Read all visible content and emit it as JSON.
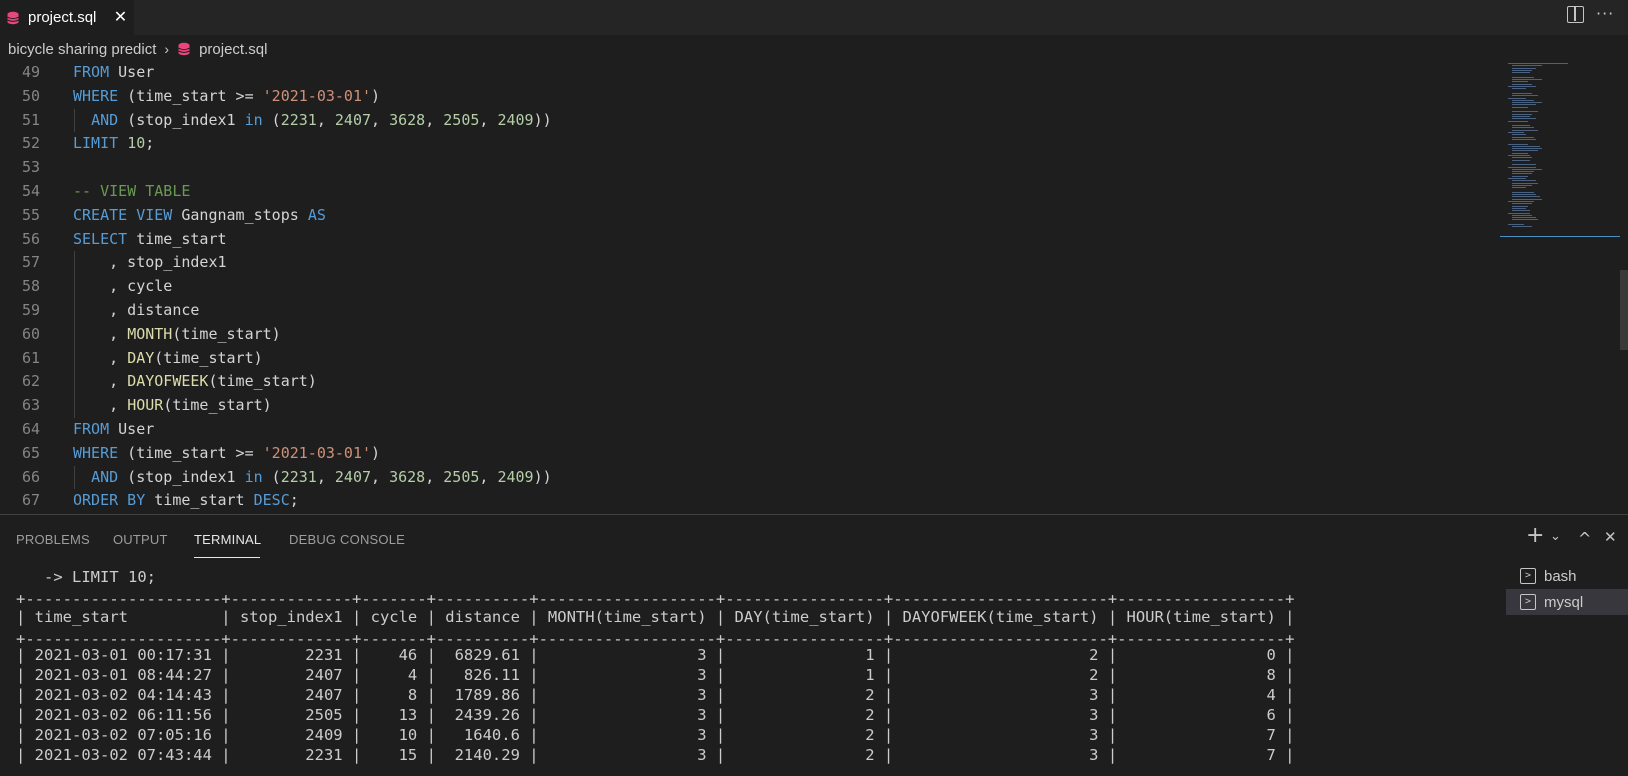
{
  "tab": {
    "label": "project.sql",
    "close": "✕"
  },
  "header_actions": {
    "more": "···"
  },
  "breadcrumb": {
    "folder": "bicycle sharing predict",
    "separator": "›",
    "file": "project.sql"
  },
  "editor": {
    "lines": [
      {
        "n": "49",
        "tokens": [
          [
            "kw",
            "FROM"
          ],
          [
            "t",
            " User"
          ]
        ]
      },
      {
        "n": "50",
        "tokens": [
          [
            "kw",
            "WHERE"
          ],
          [
            "t",
            " (time_start >= "
          ],
          [
            "str",
            "'2021-03-01'"
          ],
          [
            "t",
            ")"
          ]
        ]
      },
      {
        "n": "51",
        "tokens": [
          [
            "t",
            "  "
          ],
          [
            "kw",
            "AND"
          ],
          [
            "t",
            " (stop_index1 "
          ],
          [
            "kw",
            "in"
          ],
          [
            "t",
            " ("
          ],
          [
            "num",
            "2231"
          ],
          [
            "t",
            ", "
          ],
          [
            "num",
            "2407"
          ],
          [
            "t",
            ", "
          ],
          [
            "num",
            "3628"
          ],
          [
            "t",
            ", "
          ],
          [
            "num",
            "2505"
          ],
          [
            "t",
            ", "
          ],
          [
            "num",
            "2409"
          ],
          [
            "t",
            "))"
          ]
        ]
      },
      {
        "n": "52",
        "tokens": [
          [
            "kw",
            "LIMIT"
          ],
          [
            "t",
            " "
          ],
          [
            "num",
            "10"
          ],
          [
            "t",
            ";"
          ]
        ]
      },
      {
        "n": "53",
        "tokens": []
      },
      {
        "n": "54",
        "tokens": [
          [
            "cm",
            "-- VIEW TABLE"
          ]
        ]
      },
      {
        "n": "55",
        "tokens": [
          [
            "kw",
            "CREATE"
          ],
          [
            "t",
            " "
          ],
          [
            "kw",
            "VIEW"
          ],
          [
            "t",
            " Gangnam_stops "
          ],
          [
            "kw",
            "AS"
          ]
        ]
      },
      {
        "n": "56",
        "tokens": [
          [
            "kw",
            "SELECT"
          ],
          [
            "t",
            " time_start"
          ]
        ]
      },
      {
        "n": "57",
        "tokens": [
          [
            "t",
            "    , stop_index1"
          ]
        ]
      },
      {
        "n": "58",
        "tokens": [
          [
            "t",
            "    , cycle"
          ]
        ]
      },
      {
        "n": "59",
        "tokens": [
          [
            "t",
            "    , distance"
          ]
        ]
      },
      {
        "n": "60",
        "tokens": [
          [
            "t",
            "    , "
          ],
          [
            "fn",
            "MONTH"
          ],
          [
            "t",
            "(time_start)"
          ]
        ]
      },
      {
        "n": "61",
        "tokens": [
          [
            "t",
            "    , "
          ],
          [
            "fn",
            "DAY"
          ],
          [
            "t",
            "(time_start)"
          ]
        ]
      },
      {
        "n": "62",
        "tokens": [
          [
            "t",
            "    , "
          ],
          [
            "fn",
            "DAYOFWEEK"
          ],
          [
            "t",
            "(time_start)"
          ]
        ]
      },
      {
        "n": "63",
        "tokens": [
          [
            "t",
            "    , "
          ],
          [
            "fn",
            "HOUR"
          ],
          [
            "t",
            "(time_start)"
          ]
        ]
      },
      {
        "n": "64",
        "tokens": [
          [
            "kw",
            "FROM"
          ],
          [
            "t",
            " User"
          ]
        ]
      },
      {
        "n": "65",
        "tokens": [
          [
            "kw",
            "WHERE"
          ],
          [
            "t",
            " (time_start >= "
          ],
          [
            "str",
            "'2021-03-01'"
          ],
          [
            "t",
            ")"
          ]
        ]
      },
      {
        "n": "66",
        "tokens": [
          [
            "t",
            "  "
          ],
          [
            "kw",
            "AND"
          ],
          [
            "t",
            " (stop_index1 "
          ],
          [
            "kw",
            "in"
          ],
          [
            "t",
            " ("
          ],
          [
            "num",
            "2231"
          ],
          [
            "t",
            ", "
          ],
          [
            "num",
            "2407"
          ],
          [
            "t",
            ", "
          ],
          [
            "num",
            "3628"
          ],
          [
            "t",
            ", "
          ],
          [
            "num",
            "2505"
          ],
          [
            "t",
            ", "
          ],
          [
            "num",
            "2409"
          ],
          [
            "t",
            "))"
          ]
        ]
      },
      {
        "n": "67",
        "tokens": [
          [
            "kw",
            "ORDER BY"
          ],
          [
            "t",
            " time_start "
          ],
          [
            "kw",
            "DESC"
          ],
          [
            "t",
            ";"
          ]
        ]
      }
    ]
  },
  "panel": {
    "tabs": [
      "PROBLEMS",
      "OUTPUT",
      "TERMINAL",
      "DEBUG CONSOLE"
    ],
    "active_tab": "TERMINAL",
    "actions": {
      "add": "+",
      "dropdown": "⌄",
      "maximize": "^",
      "close": "✕"
    }
  },
  "terminal": {
    "lines": [
      "   -> LIMIT 10;",
      "+---------------------+-------------+-------+----------+-------------------+-----------------+-----------------------+------------------+",
      "| time_start          | stop_index1 | cycle | distance | MONTH(time_start) | DAY(time_start) | DAYOFWEEK(time_start) | HOUR(time_start) |",
      "+---------------------+-------------+-------+----------+-------------------+-----------------+-----------------------+------------------+",
      "| 2021-03-01 00:17:31 |        2231 |    46 |  6829.61 |                 3 |               1 |                     2 |                0 |",
      "| 2021-03-01 08:44:27 |        2407 |     4 |   826.11 |                 3 |               1 |                     2 |                8 |",
      "| 2021-03-02 04:14:43 |        2407 |     8 |  1789.86 |                 3 |               2 |                     3 |                4 |",
      "| 2021-03-02 06:11:56 |        2505 |    13 |  2439.26 |                 3 |               2 |                     3 |                6 |",
      "| 2021-03-02 07:05:16 |        2409 |    10 |   1640.6 |                 3 |               2 |                     3 |                7 |",
      "| 2021-03-02 07:43:44 |        2231 |    15 |  2140.29 |                 3 |               2 |                     3 |                7 |"
    ],
    "sessions": [
      {
        "label": "bash",
        "icon": "terminal-icon",
        "active": false
      },
      {
        "label": "mysql",
        "icon": "terminal-icon",
        "active": true
      }
    ]
  }
}
